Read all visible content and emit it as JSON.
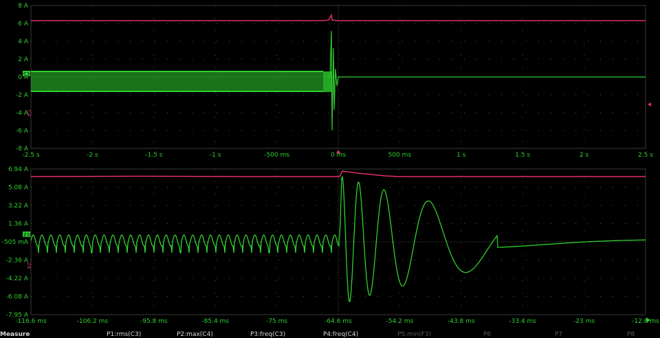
{
  "colors": {
    "background": "#000000",
    "grid": "#3a3a3a",
    "grid_dots": "#5a5a5a",
    "channel_green": "#2fd02f",
    "channel_magenta": "#e0306f",
    "trigger": "#e0306f"
  },
  "top_panel": {
    "y_ticks": [
      "8 A",
      "6 A",
      "4 A",
      "2 A",
      "0 A",
      "-2 A",
      "-4 A",
      "-6 A",
      "-8 A"
    ],
    "x_ticks": [
      "-2.5 s",
      "-2 s",
      "-1.5 s",
      "-1 s",
      "-500 ms",
      "0 ms",
      "500 ms",
      "1 s",
      "1.5 s",
      "2 s",
      "2.5 s"
    ],
    "channel_markers": {
      "green": "C3",
      "magenta": "C4"
    }
  },
  "bottom_panel": {
    "y_ticks": [
      "6.94 A",
      "5.08 A",
      "3.22 A",
      "1.36 A",
      "-505 mA",
      "-2.36 A",
      "-4.22 A",
      "-6.08 A",
      "-7.95 A"
    ],
    "x_ticks": [
      "-116.6 ms",
      "-106.2 ms",
      "-95.8 ms",
      "-85.4 ms",
      "-75 ms",
      "-64.6 ms",
      "-54.2 ms",
      "-43.8 ms",
      "-33.4 ms",
      "-23 ms",
      "-12.6 ms"
    ],
    "channel_markers": {
      "green": "Z3",
      "magenta": "Z4"
    }
  },
  "measure_bar": {
    "title": "Measure",
    "items": [
      {
        "label": "P1:rms(C3)",
        "active": true
      },
      {
        "label": "P2:max(C4)",
        "active": true
      },
      {
        "label": "P3:freq(C3)",
        "active": true
      },
      {
        "label": "P4:freq(C4)",
        "active": true
      },
      {
        "label": "P5:min(F3)",
        "active": false
      },
      {
        "label": "P6",
        "active": false
      },
      {
        "label": "P7",
        "active": false
      },
      {
        "label": "P8",
        "active": false
      }
    ]
  }
}
